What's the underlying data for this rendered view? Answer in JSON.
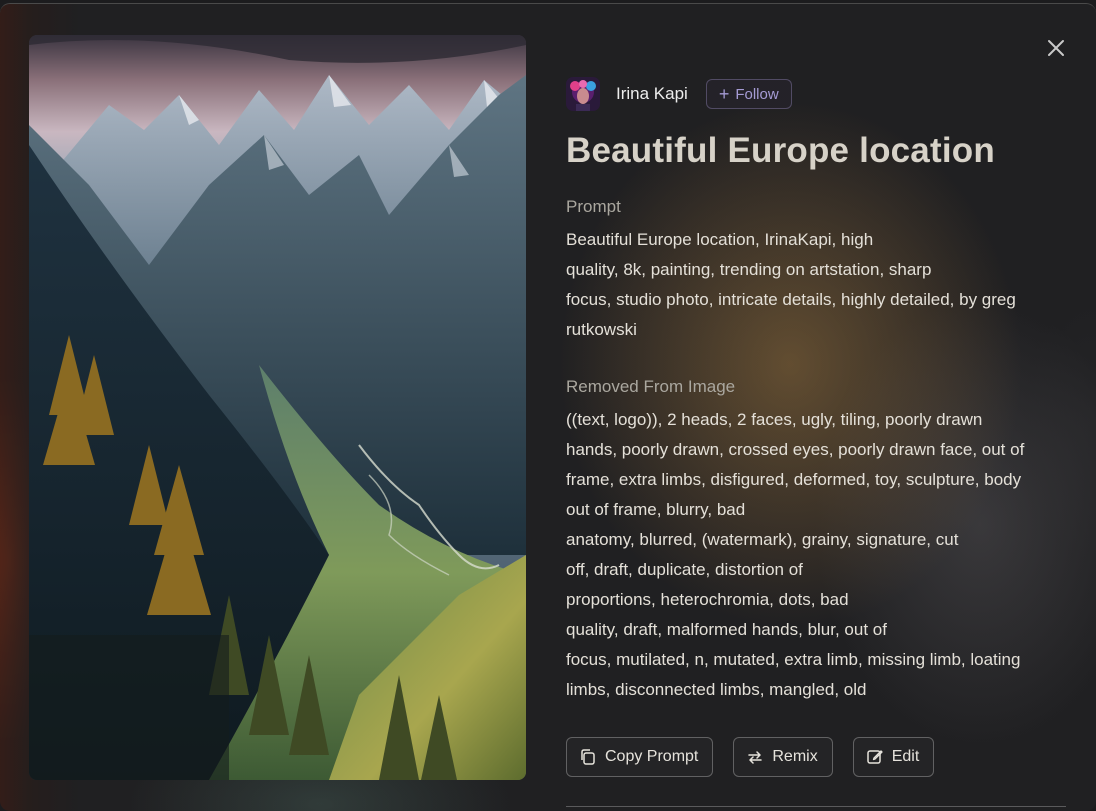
{
  "dialog": {
    "close_icon": "close-icon"
  },
  "image": {
    "subject": "mountain-valley-painting"
  },
  "author": {
    "name": "Irina Kapi",
    "follow_label": "Follow",
    "follow_icon": "plus-icon"
  },
  "title": "Beautiful Europe location",
  "prompt": {
    "label": "Prompt",
    "lines": [
      "Beautiful Europe location, IrinaKapi, high",
      "quality, 8k, painting, trending on artstation, sharp",
      "focus, studio photo, intricate details, highly detailed, by greg",
      "rutkowski"
    ]
  },
  "removed": {
    "label": "Removed From Image",
    "lines": [
      "((text, logo)), 2 heads, 2 faces, ugly, tiling, poorly drawn",
      "hands, poorly drawn, crossed eyes, poorly drawn face, out of",
      "frame, extra limbs, disfigured, deformed, toy, sculpture, body",
      "out of frame, blurry, bad",
      "anatomy, blurred, (watermark), grainy, signature, cut",
      "off, draft, duplicate, distortion of",
      "proportions, heterochromia, dots, bad",
      "quality, draft, malformed hands, blur, out of",
      "focus, mutilated, n, mutated, extra limb, missing limb, loating",
      "limbs, disconnected limbs, mangled, old"
    ]
  },
  "actions": {
    "copy_label": "Copy Prompt",
    "copy_icon": "copy-icon",
    "remix_label": "Remix",
    "remix_icon": "remix-icon",
    "edit_label": "Edit",
    "edit_icon": "edit-icon"
  },
  "colors": {
    "accent": "#a59bd4",
    "text": "#e4e0d8",
    "label": "#aaa79f"
  }
}
